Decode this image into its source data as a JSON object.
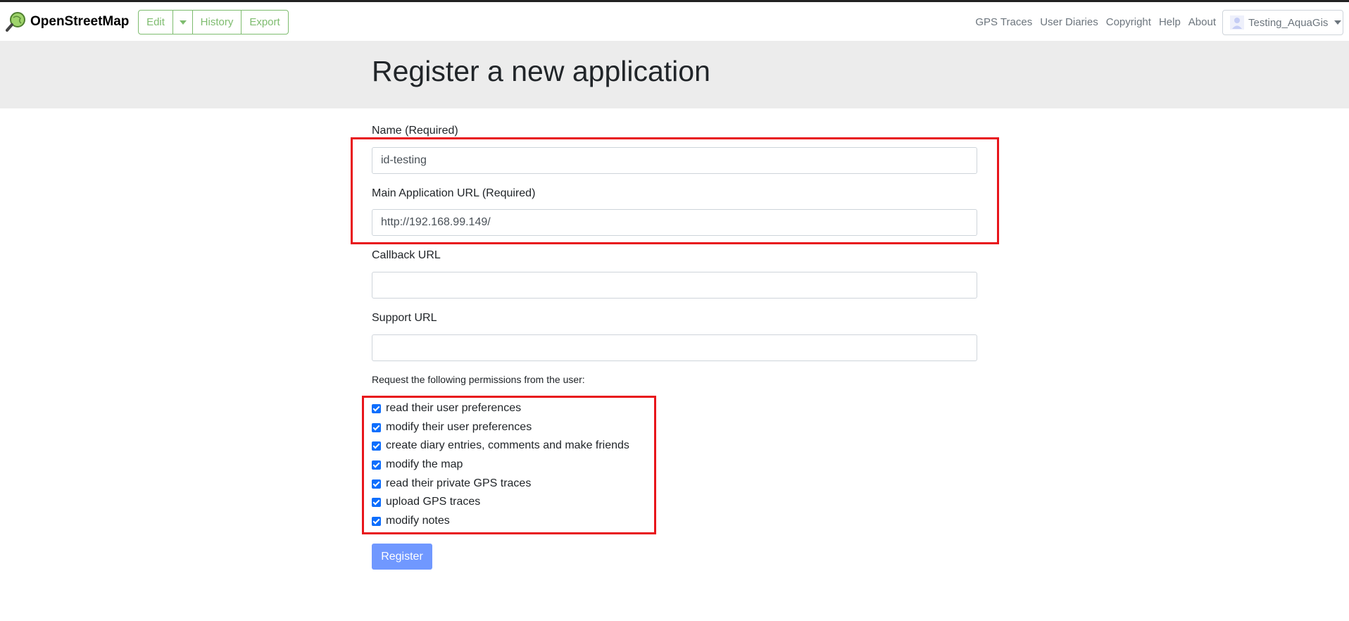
{
  "brand": {
    "name": "OpenStreetMap",
    "logo_icon": "osm-magnifier-logo-icon"
  },
  "header": {
    "edit_label": "Edit",
    "history_label": "History",
    "export_label": "Export",
    "nav": [
      "GPS Traces",
      "User Diaries",
      "Copyright",
      "Help",
      "About"
    ],
    "user": "Testing_AquaGis",
    "accent_color": "#7ebc6f"
  },
  "page": {
    "title": "Register a new application"
  },
  "form": {
    "name": {
      "label": "Name (Required)",
      "value": "id-testing"
    },
    "main_url": {
      "label": "Main Application URL (Required)",
      "value": "http://192.168.99.149/"
    },
    "callback_url": {
      "label": "Callback URL",
      "value": ""
    },
    "support_url": {
      "label": "Support URL",
      "value": ""
    },
    "permissions_label": "Request the following permissions from the user:",
    "permissions": [
      {
        "label": "read their user preferences",
        "checked": true
      },
      {
        "label": "modify their user preferences",
        "checked": true
      },
      {
        "label": "create diary entries, comments and make friends",
        "checked": true
      },
      {
        "label": "modify the map",
        "checked": true
      },
      {
        "label": "read their private GPS traces",
        "checked": true
      },
      {
        "label": "upload GPS traces",
        "checked": true
      },
      {
        "label": "modify notes",
        "checked": true
      }
    ],
    "submit_label": "Register"
  },
  "colors": {
    "highlight": "#e8151b",
    "checkbox": "#0d6efd",
    "button": "#7098ff"
  }
}
